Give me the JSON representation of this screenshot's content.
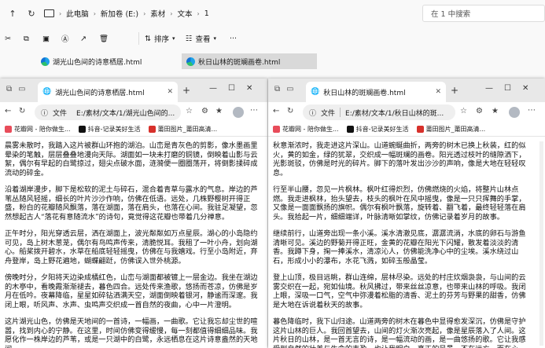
{
  "explorer": {
    "breadcrumb": [
      "此电脑",
      "新加卷 (E:)",
      "素材",
      "文本",
      "1"
    ],
    "search_placeholder": "在 1 中搜索",
    "toolbar": {
      "sort": "排序",
      "view": "查看",
      "more": "···"
    },
    "files": [
      {
        "name": "湖光山色间的诗意栖居.html",
        "selected": false
      },
      {
        "name": "秋日山林的斑斓画卷.html",
        "selected": true
      }
    ]
  },
  "browsers": [
    {
      "tab_title": "湖光山色间的诗意栖居.html",
      "url_prefix": "文件",
      "url": "E:/素材/文本/1/湖光山色间的...",
      "bookmarks": [
        "花瓣网 - 陪你做生...",
        "抖音-记录美好生活",
        "莆田图片_莆田高清..."
      ],
      "paragraphs": [
        "晨雾未散时，我踏入这片被群山环抱的湖泊。山峦是青灰色的剪影，像水墨画里晕染的笔触，层层叠叠地漫向天际。湖面如一块未打磨的铜镜，倒映着山影与云絮，偶尔有早起的白鹭掠过，翅尖点破水面，涟漪便一圈圈荡开，将倒影揉碎成流动的碎金。",
        "沿着湖岸漫步，脚下是松软的泥土与碎石，混合着青草与露水的气息。岸边的芦苇丛随风轻摇，细长的叶片沙沙作响，仿佛在低语。远处，几株野樱树开得正盛，粉白的花瓣随风飘落，落在湖面，落在肩头，也落在心间。我驻足凝望，忽然想起古人“落花有意随流水”的诗句，竟觉得这花瓣也带着几分禅意。",
        "正午时分，阳光穿透云层，洒在湖面上，波光粼粼如万点星辰。湖心的小岛隐约可见，岛上树木葱茏，偶尔有鸟鸣声传来，清脆悦耳。我租了一叶小舟，划向湖心。船桨拨开碧水，水草在船底轻轻摇曳，仿佛在与我嬉戏。行至小岛附近，弃舟登岸，岛上野花遍地，蝴蝶翩跹，仿佛误入世外桃源。",
        "傍晚时分，夕阳将天边染成橘红色，山峦与湖面都被镀上一层金边。我坐在湖边的木亭中，看晚霞渐渐褪去，暮色四合。远处传来渔歌，悠扬而苍凉，仿佛是岁月在低吟。夜幕降临，星星如碎钻洒满天空，湖面倒映着银河，静谧而深邃。我闭上眼，听风声、水声、虫鸣声交织成一首自然的夜曲，心中一片澄明。",
        "这片湖光山色，仿佛是天地间的一首诗，一幅画，一曲歌。它让我忘却尘世的喧嚣，找到内心的宁静。在这里，时间仿佛变得缓慢，每一刻都值得细细品味。我愿化作一株岸边的芦苇，或是一只湖中的白鹭，永远栖息在这片诗意盎然的天地间。"
      ]
    },
    {
      "tab_title": "秋日山林的斑斓画卷.html",
      "url_prefix": "文件",
      "url": "E:/素材/文本/1/秋日山林的斑...",
      "bookmarks": [
        "花瓣网 - 陪你做生...",
        "抖音-记录美好生活",
        "莆田图片_莆田高清..."
      ],
      "paragraphs": [
        "秋意渐浓时，我走进这片深山。山道蜿蜒曲折，两旁的树木已换上秋装，红的似火，黄的如金，绿的犹翠，交织成一幅斑斓的画卷。阳光透过枝叶的缝隙洒下，光影斑驳，仿佛是时光的碎片。脚下的落叶发出沙沙的声响，像是大地在轻轻叹息。",
        "行至半山腰，忽见一片枫林。枫叶红得炽烈，仿佛燃烧的火焰，将整片山林点燃。我走进枫林，抬头望去，枝头的枫叶在风中摇曳，像是一只只挥舞的手掌，又像是一面面飘扬的旗帜。偶尔有枫叶飘落，旋转着、翻飞着，最终轻轻落在肩头。我拾起一片，细细端详，叶脉清晰如掌纹，仿佛记录着岁月的故事。",
        "继续前行，山道旁出现一条小溪。溪水清澈见底，潺潺流淌，水底的卵石与游鱼清晰可见。溪边的野菊开得正旺，金黄的花瓣在阳光下闪耀，散发着淡淡的清香。我蹲下身，掬一捧溪水，清凉沁人，仿佛能洗净心中的尘埃。溪水绕过山石，形成小小的瀑布，水花飞溅，如碎玉般晶莹。",
        "登上山顶，极目远眺，群山连绵，层林尽染。远处的村庄炊烟袅袅，与山间的云雾交织在一起，宛如仙境。秋风拂过，带来丝丝凉意，也带来山林的呼吸。我闭上眼，深吸一口气，空气中弥漫着松脂的清香、泥土的芬芳与野果的甜香，仿佛是大地在诉说着秋天的故事。",
        "暮色降临时，我下山归途。山道两旁的树木在暮色中显得愈发深沉，仿佛是守护这片山林的巨人。我回首望去，山间的灯火渐次亮起，像是星辰落入了人间。这片秋日的山林，是一首无言的诗，是一幅流动的画，是一曲悠扬的歌。它让我感受到自然的壮美与生命的丰盈，也让我明白，真正的风景，不在远方，而在心中。"
      ]
    }
  ]
}
